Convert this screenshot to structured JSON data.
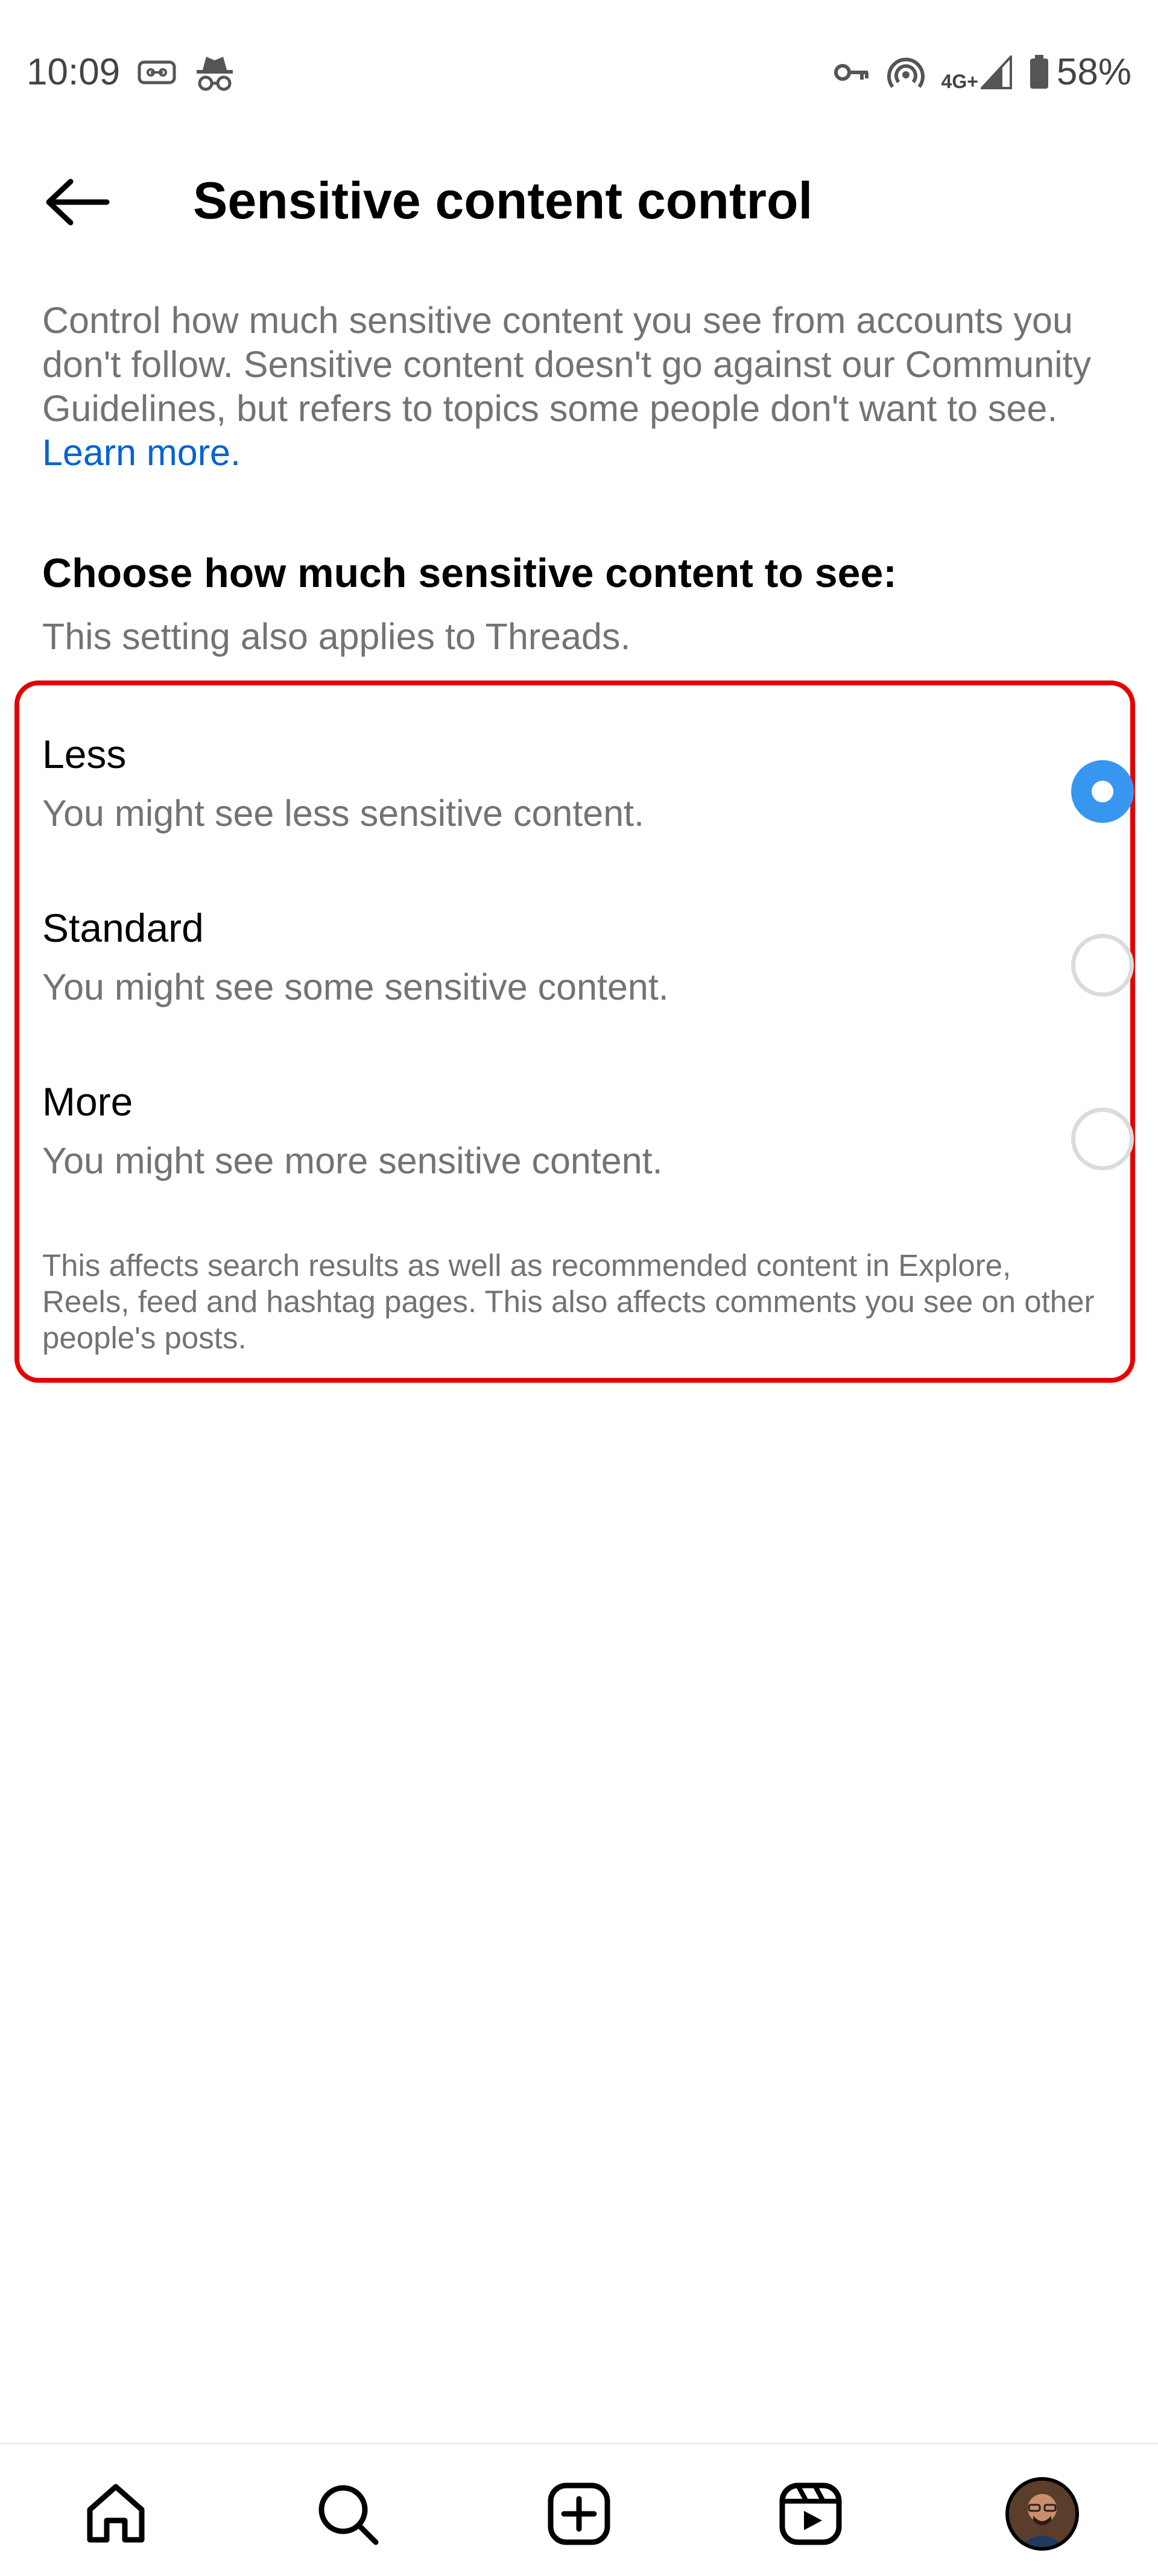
{
  "status_bar": {
    "time": "10:09",
    "network": "4G+",
    "battery": "58%",
    "icons": [
      "cassette-icon",
      "incognito-icon",
      "vpn-key-icon",
      "hotspot-icon",
      "signal-icon",
      "battery-icon"
    ]
  },
  "header": {
    "title": "Sensitive content control",
    "back_icon": "back-arrow-icon"
  },
  "description": {
    "text": "Control how much sensitive content you see from accounts you don't follow. Sensitive content doesn't go against our Community Guidelines, but refers to topics some people don't want to see.",
    "link": "Learn more."
  },
  "section": {
    "heading": "Choose how much sensitive content to see:",
    "subtitle": "This setting also applies to Threads."
  },
  "options": [
    {
      "title": "Less",
      "description": "You might see less sensitive content.",
      "selected": true
    },
    {
      "title": "Standard",
      "description": "You might see some sensitive content.",
      "selected": false
    },
    {
      "title": "More",
      "description": "You might see more sensitive content.",
      "selected": false
    }
  ],
  "footnote": "This affects search results as well as recommended content in Explore, Reels, feed and hashtag pages. This also affects comments you see on other people's posts.",
  "highlight_color": "#e60000",
  "accent_color": "#3797f0",
  "link_color": "#0064d1",
  "bottom_nav": {
    "items": [
      "home-icon",
      "search-icon",
      "create-icon",
      "reels-icon",
      "profile-avatar"
    ]
  }
}
